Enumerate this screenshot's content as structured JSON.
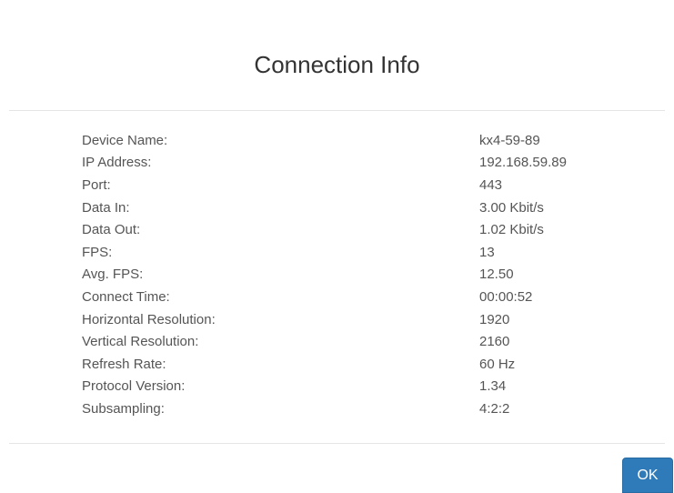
{
  "dialog": {
    "title": "Connection Info",
    "rows": [
      {
        "label": "Device Name:",
        "value": "kx4-59-89"
      },
      {
        "label": "IP Address:",
        "value": "192.168.59.89"
      },
      {
        "label": "Port:",
        "value": "443"
      },
      {
        "label": "Data In:",
        "value": "3.00 Kbit/s"
      },
      {
        "label": "Data Out:",
        "value": "1.02 Kbit/s"
      },
      {
        "label": "FPS:",
        "value": "13"
      },
      {
        "label": "Avg. FPS:",
        "value": "12.50"
      },
      {
        "label": "Connect Time:",
        "value": "00:00:52"
      },
      {
        "label": "Horizontal Resolution:",
        "value": "1920"
      },
      {
        "label": "Vertical Resolution:",
        "value": "2160"
      },
      {
        "label": "Refresh Rate:",
        "value": "60 Hz"
      },
      {
        "label": "Protocol Version:",
        "value": "1.34"
      },
      {
        "label": "Subsampling:",
        "value": "4:2:2"
      }
    ],
    "ok_label": "OK"
  },
  "colors": {
    "primary_button": "#2f7ab8",
    "text": "#555555",
    "divider": "#e5e5e5"
  }
}
